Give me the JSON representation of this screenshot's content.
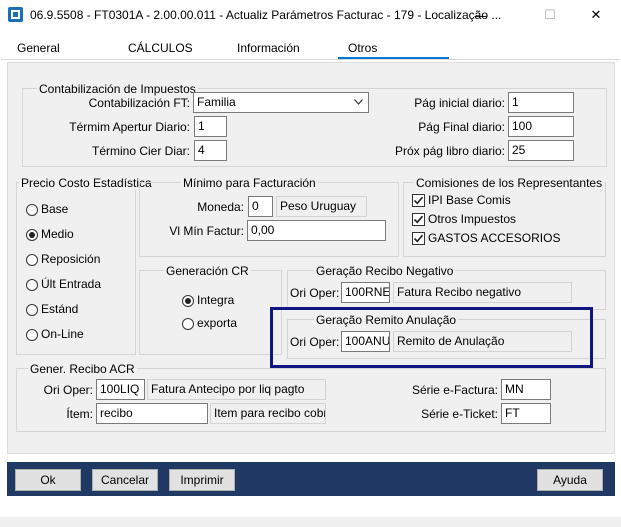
{
  "window": {
    "title": "06.9.5508 - FT0301A - 2.00.00.011 - Actualiz Parámetros Facturac - 179 - Localização ...",
    "minimize": "—",
    "maximize": "☐",
    "close": "✕"
  },
  "tabs": [
    {
      "label": "General"
    },
    {
      "label": "CÁLCULOS"
    },
    {
      "label": "Información"
    },
    {
      "label": "Otros"
    }
  ],
  "contab": {
    "title": "Contabilización de Impuestos",
    "ft_label": "Contabilización FT:",
    "ft_value": "Familia",
    "termin_apertur_label": "Térmim Apertur Diario:",
    "termin_apertur_value": "1",
    "termino_cier_label": "Término Cier Diar:",
    "termino_cier_value": "4",
    "pag_inicial_label": "Pág inicial diario:",
    "pag_inicial_value": "1",
    "pag_final_label": "Pág Final diario:",
    "pag_final_value": "100",
    "prox_pag_label": "Próx pág libro diario:",
    "prox_pag_value": "25"
  },
  "precio": {
    "title": "Precio Costo Estadística",
    "options": [
      "Base",
      "Medio",
      "Reposición",
      "Últ Entrada",
      "Estánd",
      "On-Line"
    ],
    "selected": "Medio"
  },
  "minimo": {
    "title": "Mínimo para Facturación",
    "moneda_label": "Moneda:",
    "moneda_value": "0",
    "moneda_desc": "Peso Uruguay",
    "vl_min_label": "Vl Mín Factur:",
    "vl_min_value": "0,00"
  },
  "comisiones": {
    "title": "Comisiones de los Representantes",
    "items": [
      "IPI Base Comis",
      "Otros Impuestos",
      "GASTOS ACCESORIOS"
    ],
    "checked": [
      true,
      true,
      true
    ]
  },
  "generacion_cr": {
    "title": "Generación CR",
    "options": [
      "Integra",
      "exporta"
    ],
    "selected": "Integra"
  },
  "recibo_negativo": {
    "title": "Geração Recibo Negativo",
    "ori_oper_label": "Ori Oper:",
    "ori_oper_value": "100RNE",
    "desc": "Fatura Recibo negativo"
  },
  "remito_anulacao": {
    "title": "Geração Remito Anulação",
    "ori_oper_label": "Ori Oper:",
    "ori_oper_value": "100ANU",
    "desc": "Remito de Anulação"
  },
  "recibo_acr": {
    "title": "Gener. Recibo ACR",
    "ori_oper_label": "Ori Oper:",
    "ori_oper_value": "100LIQ",
    "ori_oper_desc": "Fatura Antecipo por liq pagto",
    "item_label": "Ítem:",
    "item_value": "recibo",
    "item_desc": "Item para recibo cobranz",
    "serie_efactura_label": "Série e-Factura:",
    "serie_efactura_value": "MN",
    "serie_eticket_label": "Série e-Ticket:",
    "serie_eticket_value": "FT"
  },
  "buttons": {
    "ok": "Ok",
    "cancelar": "Cancelar",
    "imprimir": "Imprimir",
    "ayuda": "Ayuda"
  },
  "colors": {
    "tab_accent": "#0078d7",
    "bottom_bar": "#1f3864",
    "highlight_frame": "#0f1680"
  }
}
